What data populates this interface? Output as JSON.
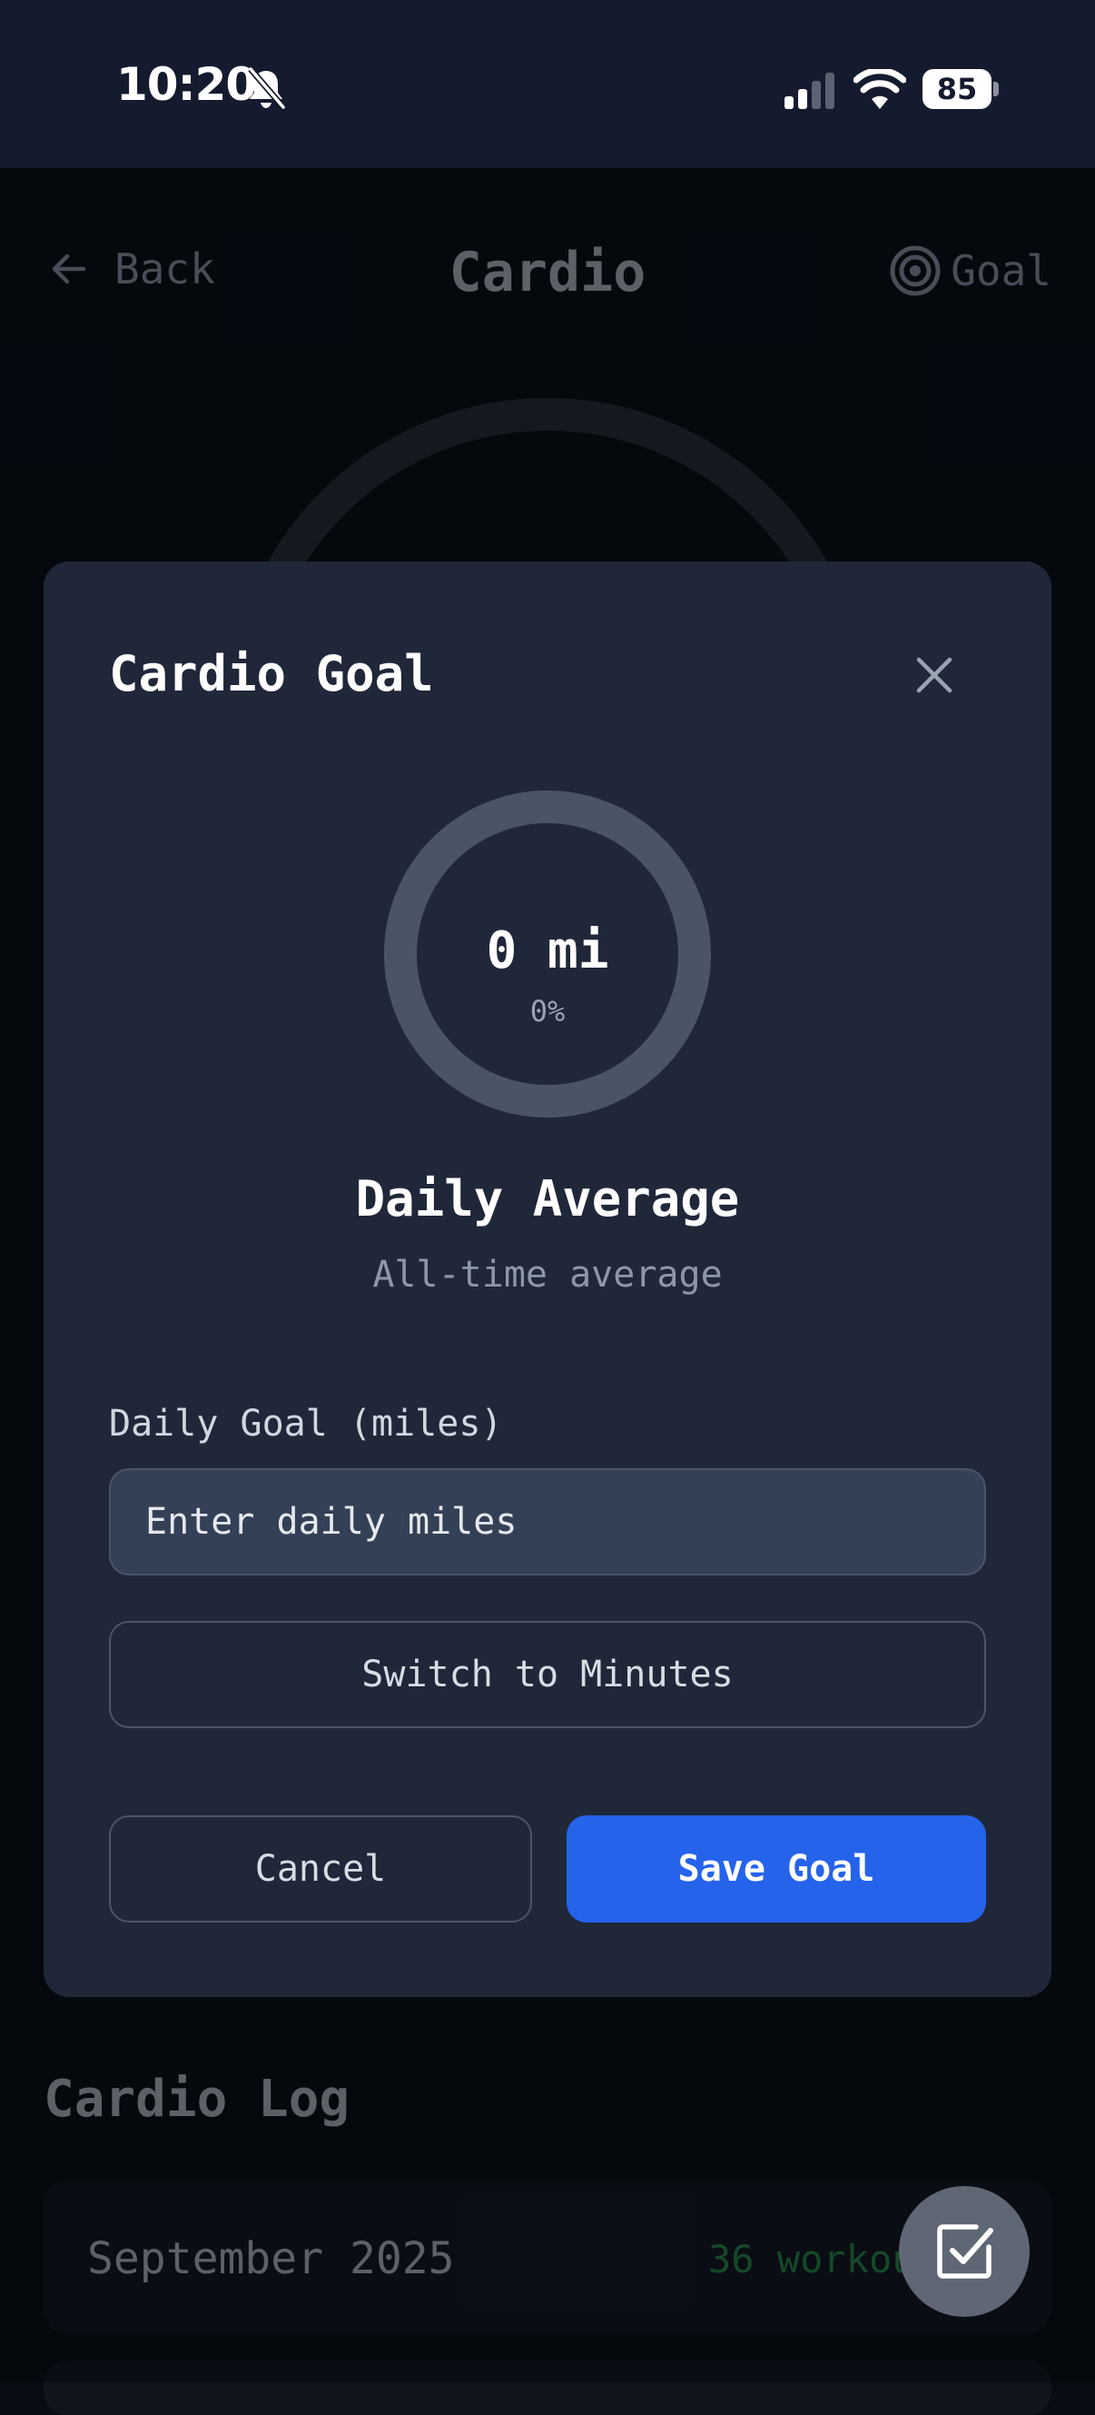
{
  "status_bar": {
    "time": "10:20",
    "battery": "85",
    "icons": [
      "bell-slash-icon",
      "signal-icon",
      "wifi-icon",
      "battery-icon"
    ]
  },
  "header": {
    "back_label": "Back",
    "title": "Cardio",
    "goal_label": "Goal",
    "icons": [
      "arrow-left-icon",
      "target-icon"
    ]
  },
  "log": {
    "title": "Cardio Log",
    "month_label": "September 2025",
    "workout_count": "36 workouts"
  },
  "fab": {
    "icon": "checkbox-edit-icon"
  },
  "modal": {
    "title": "Cardio Goal",
    "close_icon": "close-icon",
    "ring": {
      "value": "0 mi",
      "percent_label": "0%",
      "progress": 0
    },
    "average_heading": "Daily Average",
    "average_subtitle": "All-time average",
    "input_label": "Daily Goal (miles)",
    "input_placeholder": "Enter daily miles",
    "input_value": "",
    "switch_label": "Switch to Minutes",
    "cancel_label": "Cancel",
    "save_label": "Save Goal"
  },
  "colors": {
    "accent": "#2563eb",
    "modal_bg": "#1f2739",
    "page_bg": "#080c14",
    "status_bar_bg": "#151b2e",
    "success_green": "#1f6b3b"
  }
}
